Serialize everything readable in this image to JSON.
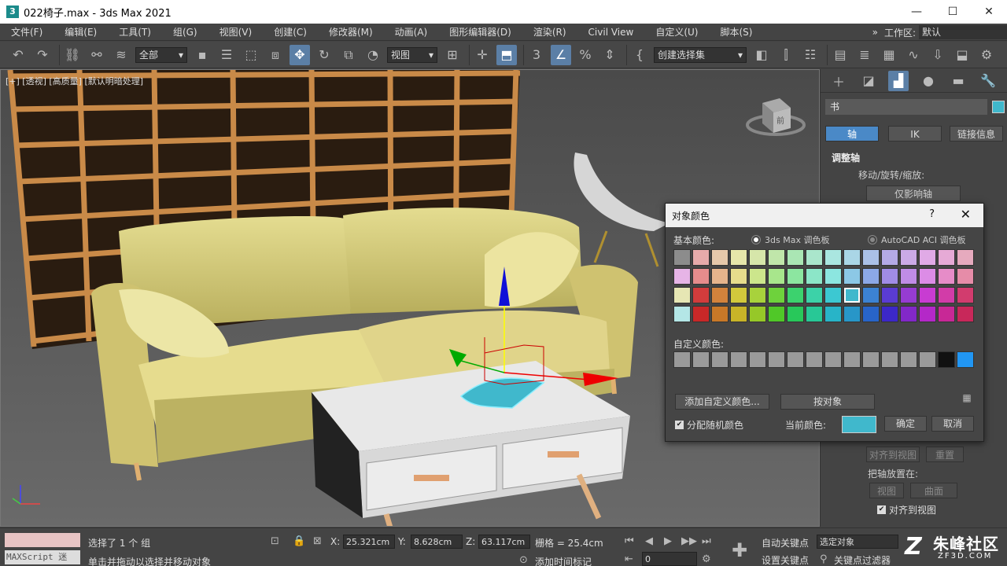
{
  "window": {
    "title": "022椅子.max - 3ds Max 2021",
    "app_icon": "3",
    "minimize": "—",
    "maximize": "☐",
    "close": "✕"
  },
  "menu": [
    "文件(F)",
    "编辑(E)",
    "工具(T)",
    "组(G)",
    "视图(V)",
    "创建(C)",
    "修改器(M)",
    "动画(A)",
    "图形编辑器(D)",
    "渲染(R)",
    "Civil View",
    "自定义(U)",
    "脚本(S)"
  ],
  "workspace": {
    "more": "»",
    "label": "工作区:",
    "value": "默认"
  },
  "toolbar": {
    "selection_filter": "全部",
    "ref_coord": "视图",
    "named_selection": "创建选择集",
    "snap_value": "3"
  },
  "viewport": {
    "label": "[+] [透视] [高质量] [默认明暗处理]",
    "viewcube": "前"
  },
  "command_panel": {
    "object_name": "书",
    "object_color": "#40b8cc",
    "tabs": [
      "轴",
      "IK",
      "链接信息"
    ],
    "rollout_title": "调整轴",
    "move_rotate_scale": "移动/旋转/缩放:",
    "affect_pivot_only": "仅影响轴",
    "align_to_view": "对齐到视图",
    "reset": "重置",
    "place_pivot_on": "把轴放置在:",
    "view": "视图",
    "surface": "曲面",
    "align_to_view_check": "对齐到视图"
  },
  "dialog": {
    "title": "对象颜色",
    "help": "?",
    "close": "✕",
    "basic_colors": "基本颜色:",
    "palette_max": "3ds Max 调色板",
    "palette_aci": "AutoCAD ACI 调色板",
    "custom_colors": "自定义颜色:",
    "add_custom": "添加自定义颜色...",
    "by_object": "按对象",
    "assign_random": "分配随机颜色",
    "current_color": "当前颜色:",
    "current_color_value": "#40b8cc",
    "ok": "确定",
    "cancel": "取消",
    "palette_rows": [
      [
        "#8c8c8c",
        "#e6aaaa",
        "#e6c8aa",
        "#e6e6aa",
        "#d6e6aa",
        "#c0e6aa",
        "#aae6b4",
        "#aae6cc",
        "#aae6e0",
        "#aad6e6",
        "#aac0e6",
        "#b4aae6",
        "#cbaae6",
        "#e0aae6",
        "#e6aad6",
        "#e6aabe"
      ],
      [
        "#e6b4e6",
        "#e68c8c",
        "#e6b48c",
        "#e6dc8c",
        "#cce68c",
        "#a8e68c",
        "#8ce6a0",
        "#8ce6c8",
        "#8ce6e0",
        "#8cc8e6",
        "#8ca8e6",
        "#a08ce6",
        "#c08ce6",
        "#dc8ce6",
        "#e68cc8",
        "#e68ca8"
      ],
      [
        "#e6e6b4",
        "#d23c3c",
        "#d2823c",
        "#d2c83c",
        "#a8d23c",
        "#6ed23c",
        "#3cd26e",
        "#3cd2a8",
        "#3cc8d2",
        "#40b8cc",
        "#3c82d2",
        "#5a3cd2",
        "#963cd2",
        "#c83cd2",
        "#d23ca8",
        "#d23c6e"
      ],
      [
        "#b4e6e6",
        "#c82828",
        "#c87828",
        "#c8b428",
        "#96c828",
        "#50c828",
        "#28c85a",
        "#28c896",
        "#28b4c8",
        "#2896c8",
        "#2864c8",
        "#3c28c8",
        "#8228c8",
        "#b428c8",
        "#c82896",
        "#c8285a"
      ]
    ],
    "custom_row": [
      "#9a9a9a",
      "#9a9a9a",
      "#9a9a9a",
      "#9a9a9a",
      "#9a9a9a",
      "#9a9a9a",
      "#9a9a9a",
      "#9a9a9a",
      "#9a9a9a",
      "#9a9a9a",
      "#9a9a9a",
      "#9a9a9a",
      "#9a9a9a",
      "#9a9a9a",
      "#111111",
      "#2196f3"
    ]
  },
  "status": {
    "selected": "选择了 1 个 组",
    "hint": "单击并拖动以选择并移动对象",
    "maxscript": "MAXScript 迷",
    "x_label": "X:",
    "x_value": "25.321cm",
    "y_label": "Y:",
    "y_value": "8.628cm",
    "z_label": "Z:",
    "z_value": "63.117cm",
    "grid": "栅格 = 25.4cm",
    "add_time_tag": "添加时间标记",
    "frame": "0",
    "auto_key": "自动关键点",
    "set_key": "设置关键点",
    "selected_object": "选定对象",
    "key_filters": "关键点过滤器"
  },
  "watermark": {
    "logo": "Z",
    "name": "朱峰社区",
    "url": "ZF3D.COM"
  }
}
